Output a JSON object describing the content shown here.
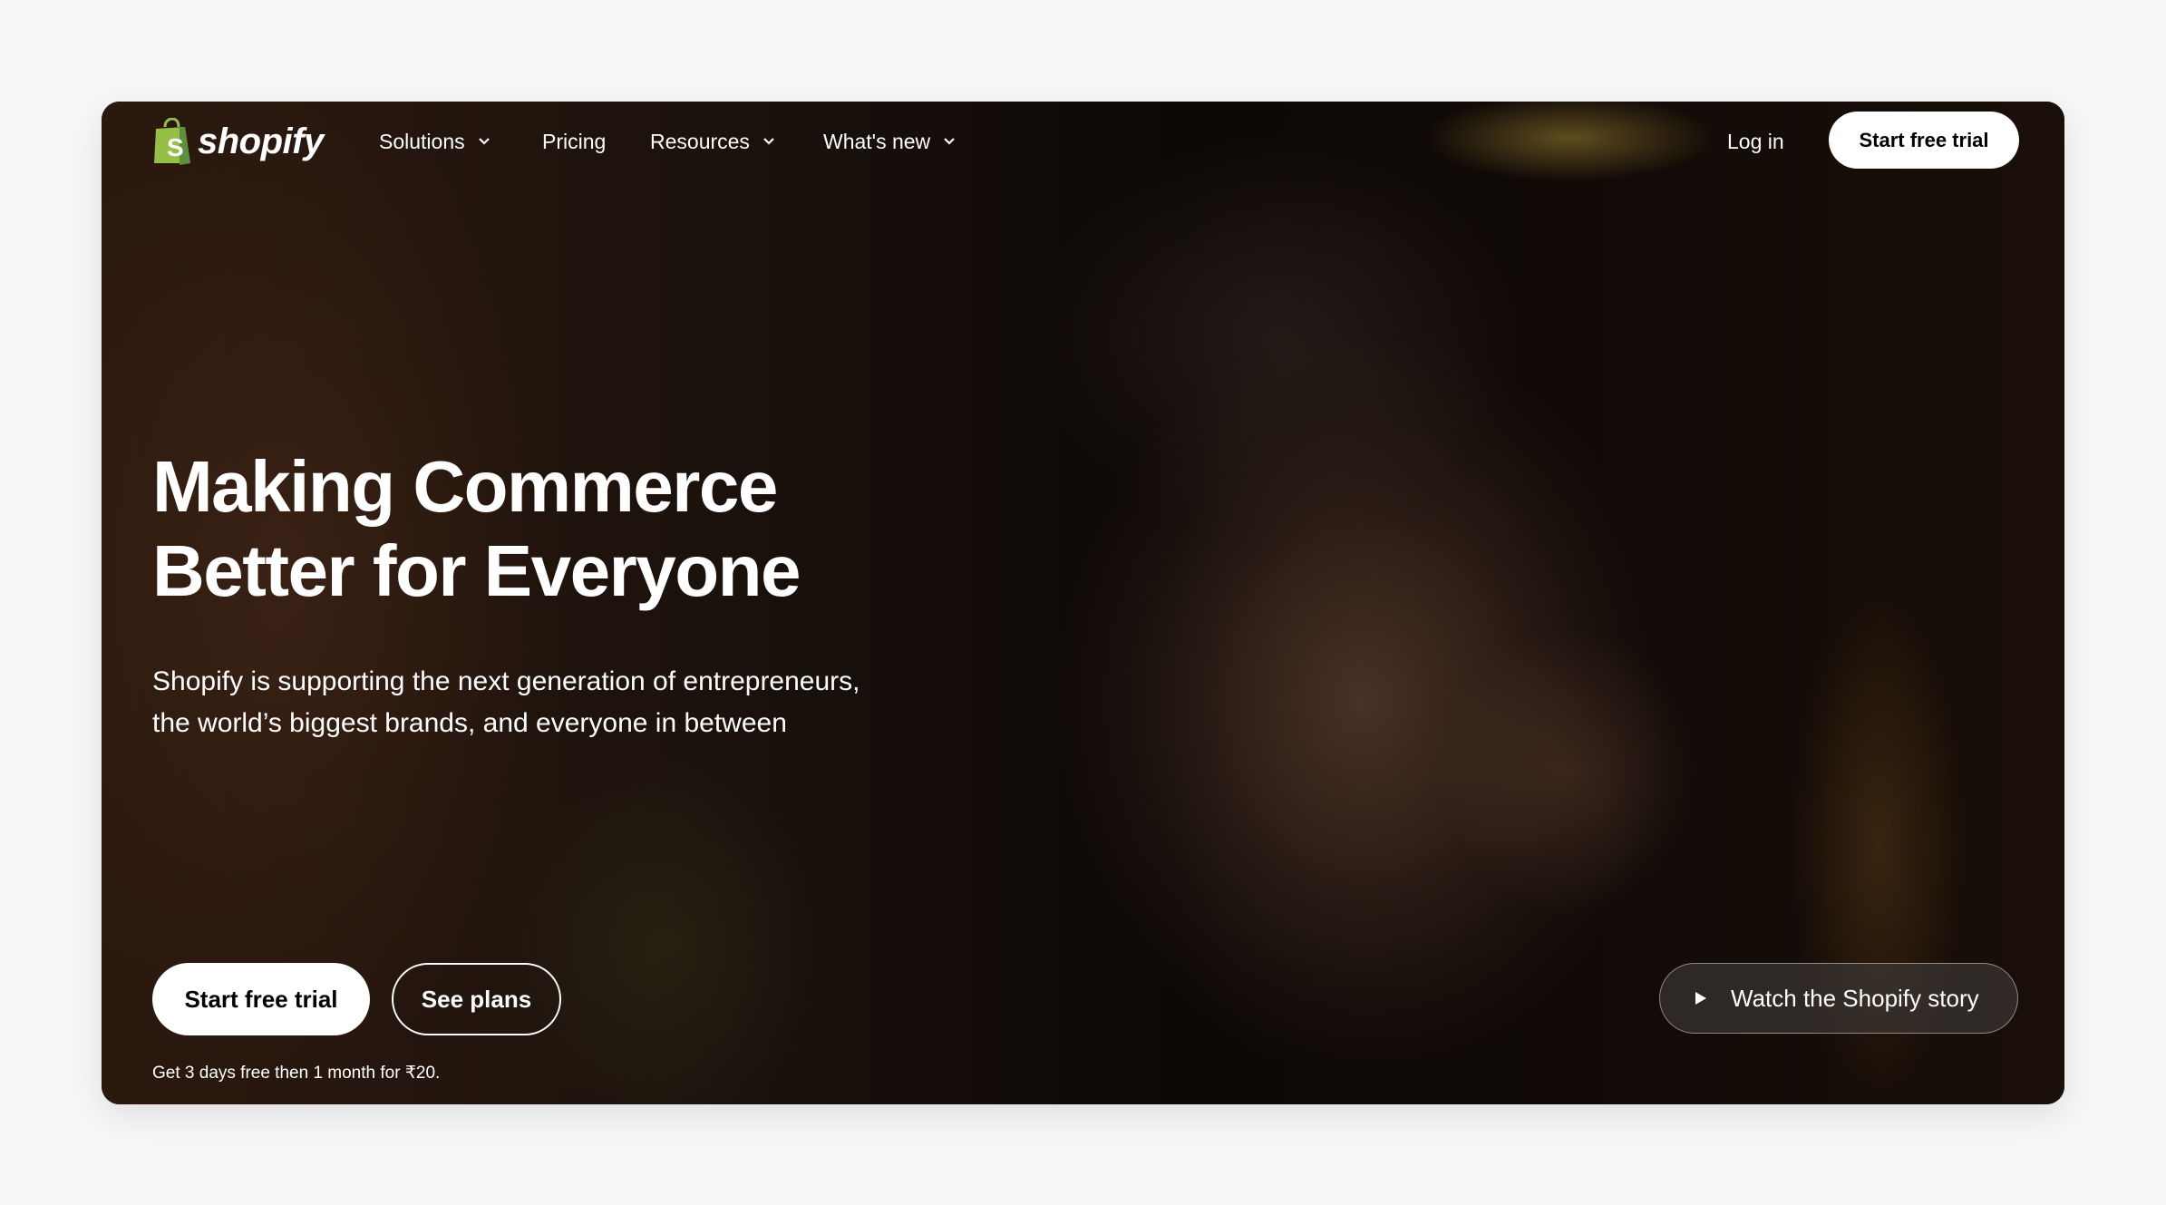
{
  "brand": {
    "name": "shopify",
    "logo_icon": "shopping-bag-icon",
    "logo_color": "#95bf47"
  },
  "nav": {
    "items": [
      {
        "label": "Solutions",
        "has_dropdown": true
      },
      {
        "label": "Pricing",
        "has_dropdown": false
      },
      {
        "label": "Resources",
        "has_dropdown": true
      },
      {
        "label": "What's new",
        "has_dropdown": true
      }
    ],
    "login_label": "Log in",
    "cta_label": "Start free trial"
  },
  "hero": {
    "title_line1": "Making Commerce",
    "title_line2": "Better for Everyone",
    "subtitle_line1": "Shopify is supporting the next generation of entrepreneurs,",
    "subtitle_line2": "the world’s biggest brands, and everyone in between",
    "primary_cta": "Start free trial",
    "secondary_cta": "See plans",
    "footnote": "Get 3 days free then 1 month for ₹20.",
    "video_button": {
      "label": "Watch the Shopify story",
      "icon": "play-icon"
    }
  },
  "colors": {
    "page_bg": "#f7f7f7",
    "button_bg": "#ffffff",
    "text": "#ffffff"
  }
}
